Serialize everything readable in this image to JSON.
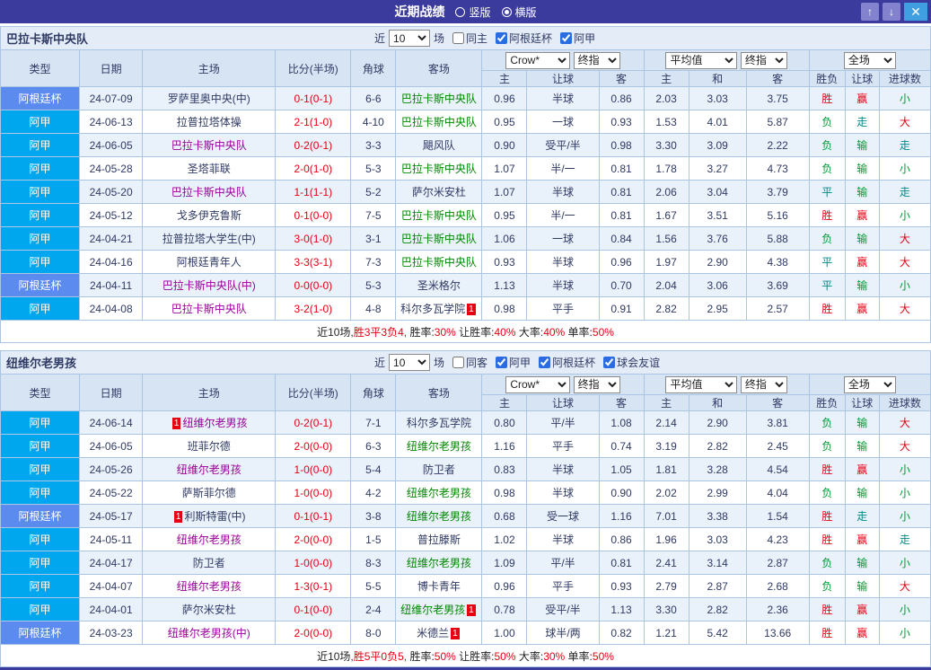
{
  "colors": {
    "titlebar": "#3b3b9e",
    "cup": "#5b8bee",
    "league": "#00a6ee",
    "red": "#e60012",
    "green": "#009933",
    "teal": "#008b8b",
    "focus-home": "#990099",
    "focus-away": "#008800",
    "navy": "#2f3a64",
    "head-bg": "#d7e4f4",
    "bar-bg": "#e4ecf7",
    "row-alt": "#e9f1fa",
    "border": "#aac6e4",
    "btn-arrow": "#8282cf",
    "btn-close": "#3f9fe0"
  },
  "titlebar": {
    "title": "近期战绩",
    "radios": [
      {
        "label": "竖版",
        "checked": false
      },
      {
        "label": "横版",
        "checked": true
      }
    ],
    "buttons": {
      "up": "↑",
      "down": "↓",
      "close": "✕"
    }
  },
  "table_head": {
    "type": "类型",
    "date": "日期",
    "home": "主场",
    "score": "比分(半场)",
    "corner": "角球",
    "away": "客场",
    "odds_home": "主",
    "odds_handicap": "让球",
    "odds_away": "客",
    "avg_home": "主",
    "avg_draw": "和",
    "avg_away": "客",
    "result": "胜负",
    "cover": "让球",
    "goals": "进球数"
  },
  "sections": [
    {
      "team": "巴拉卡斯中央队",
      "filters": {
        "near": "近",
        "count": "10",
        "games": "场",
        "checkboxes": [
          {
            "label": "同主",
            "checked": false
          },
          {
            "label": "阿根廷杯",
            "checked": true
          },
          {
            "label": "阿甲",
            "checked": true
          }
        ]
      },
      "selects": {
        "book": "Crow*",
        "book_mode": "终指",
        "avg": "平均值",
        "avg_mode": "终指",
        "scope": "全场"
      },
      "rows": [
        {
          "type": "阿根廷杯",
          "type_cls": "cup",
          "date": "24-07-09",
          "home": "罗萨里奥中央(中)",
          "home_cls": "other",
          "score": "0-1(0-1)",
          "corner": "6-6",
          "away": "巴拉卡斯中央队",
          "away_cls": "focus-away",
          "o1": "0.96",
          "hc": "半球",
          "o2": "0.86",
          "a1": "2.03",
          "a2": "3.03",
          "a3": "3.75",
          "res": "胜",
          "res_o": "win",
          "cov": "赢",
          "cov_o": "win",
          "gl": "小",
          "gl_o": "under"
        },
        {
          "type": "阿甲",
          "type_cls": "league",
          "date": "24-06-13",
          "home": "拉普拉塔体操",
          "home_cls": "other",
          "score": "2-1(1-0)",
          "corner": "4-10",
          "away": "巴拉卡斯中央队",
          "away_cls": "focus-away",
          "o1": "0.95",
          "hc": "一球",
          "o2": "0.93",
          "a1": "1.53",
          "a2": "4.01",
          "a3": "5.87",
          "res": "负",
          "res_o": "loss",
          "cov": "走",
          "cov_o": "push",
          "gl": "大",
          "gl_o": "over"
        },
        {
          "type": "阿甲",
          "type_cls": "league",
          "date": "24-06-05",
          "home": "巴拉卡斯中央队",
          "home_cls": "focus-home",
          "score": "0-2(0-1)",
          "corner": "3-3",
          "away": "飓风队",
          "away_cls": "other",
          "o1": "0.90",
          "hc": "受平/半",
          "o2": "0.98",
          "a1": "3.30",
          "a2": "3.09",
          "a3": "2.22",
          "res": "负",
          "res_o": "loss",
          "cov": "输",
          "cov_o": "loss",
          "gl": "走",
          "gl_o": "push"
        },
        {
          "type": "阿甲",
          "type_cls": "league",
          "date": "24-05-28",
          "home": "圣塔菲联",
          "home_cls": "other",
          "score": "2-0(1-0)",
          "corner": "5-3",
          "away": "巴拉卡斯中央队",
          "away_cls": "focus-away",
          "o1": "1.07",
          "hc": "半/一",
          "o2": "0.81",
          "a1": "1.78",
          "a2": "3.27",
          "a3": "4.73",
          "res": "负",
          "res_o": "loss",
          "cov": "输",
          "cov_o": "loss",
          "gl": "小",
          "gl_o": "under"
        },
        {
          "type": "阿甲",
          "type_cls": "league",
          "date": "24-05-20",
          "home": "巴拉卡斯中央队",
          "home_cls": "focus-home",
          "score": "1-1(1-1)",
          "corner": "5-2",
          "away": "萨尔米安杜",
          "away_cls": "other",
          "o1": "1.07",
          "hc": "半球",
          "o2": "0.81",
          "a1": "2.06",
          "a2": "3.04",
          "a3": "3.79",
          "res": "平",
          "res_o": "draw",
          "cov": "输",
          "cov_o": "loss",
          "gl": "走",
          "gl_o": "push"
        },
        {
          "type": "阿甲",
          "type_cls": "league",
          "date": "24-05-12",
          "home": "戈多伊克鲁斯",
          "home_cls": "other",
          "score": "0-1(0-0)",
          "corner": "7-5",
          "away": "巴拉卡斯中央队",
          "away_cls": "focus-away",
          "o1": "0.95",
          "hc": "半/一",
          "o2": "0.81",
          "a1": "1.67",
          "a2": "3.51",
          "a3": "5.16",
          "res": "胜",
          "res_o": "win",
          "cov": "赢",
          "cov_o": "win",
          "gl": "小",
          "gl_o": "under"
        },
        {
          "type": "阿甲",
          "type_cls": "league",
          "date": "24-04-21",
          "home": "拉普拉塔大学生(中)",
          "home_cls": "other",
          "score": "3-0(1-0)",
          "corner": "3-1",
          "away": "巴拉卡斯中央队",
          "away_cls": "focus-away",
          "o1": "1.06",
          "hc": "一球",
          "o2": "0.84",
          "a1": "1.56",
          "a2": "3.76",
          "a3": "5.88",
          "res": "负",
          "res_o": "loss",
          "cov": "输",
          "cov_o": "loss",
          "gl": "大",
          "gl_o": "over"
        },
        {
          "type": "阿甲",
          "type_cls": "league",
          "date": "24-04-16",
          "home": "阿根廷青年人",
          "home_cls": "other",
          "score": "3-3(3-1)",
          "corner": "7-3",
          "away": "巴拉卡斯中央队",
          "away_cls": "focus-away",
          "o1": "0.93",
          "hc": "半球",
          "o2": "0.96",
          "a1": "1.97",
          "a2": "2.90",
          "a3": "4.38",
          "res": "平",
          "res_o": "draw",
          "cov": "赢",
          "cov_o": "win",
          "gl": "大",
          "gl_o": "over"
        },
        {
          "type": "阿根廷杯",
          "type_cls": "cup",
          "date": "24-04-11",
          "home": "巴拉卡斯中央队(中)",
          "home_cls": "focus-home",
          "score": "0-0(0-0)",
          "corner": "5-3",
          "away": "圣米格尔",
          "away_cls": "other",
          "o1": "1.13",
          "hc": "半球",
          "o2": "0.70",
          "a1": "2.04",
          "a2": "3.06",
          "a3": "3.69",
          "res": "平",
          "res_o": "draw",
          "cov": "输",
          "cov_o": "loss",
          "gl": "小",
          "gl_o": "under"
        },
        {
          "type": "阿甲",
          "type_cls": "league",
          "date": "24-04-08",
          "home": "巴拉卡斯中央队",
          "home_cls": "focus-home",
          "score": "3-2(1-0)",
          "corner": "4-8",
          "away": "科尔多瓦学院",
          "away_cls": "other",
          "away_badge": {
            "pos": "after",
            "text": "1"
          },
          "o1": "0.98",
          "hc": "平手",
          "o2": "0.91",
          "a1": "2.82",
          "a2": "2.95",
          "a3": "2.57",
          "res": "胜",
          "res_o": "win",
          "cov": "赢",
          "cov_o": "win",
          "gl": "大",
          "gl_o": "over"
        }
      ],
      "footer": [
        {
          "text": "近10场,",
          "red": false
        },
        {
          "text": "胜3平3负4,",
          "red": true
        },
        {
          "text": " 胜率:",
          "red": false
        },
        {
          "text": "30%",
          "red": true
        },
        {
          "text": " 让胜率:",
          "red": false
        },
        {
          "text": "40%",
          "red": true
        },
        {
          "text": " 大率:",
          "red": false
        },
        {
          "text": "40%",
          "red": true
        },
        {
          "text": " 单率:",
          "red": false
        },
        {
          "text": "50%",
          "red": true
        }
      ]
    },
    {
      "team": "纽维尔老男孩",
      "filters": {
        "near": "近",
        "count": "10",
        "games": "场",
        "checkboxes": [
          {
            "label": "同客",
            "checked": false
          },
          {
            "label": "阿甲",
            "checked": true
          },
          {
            "label": "阿根廷杯",
            "checked": true
          },
          {
            "label": "球会友谊",
            "checked": true
          }
        ]
      },
      "selects": {
        "book": "Crow*",
        "book_mode": "终指",
        "avg": "平均值",
        "avg_mode": "终指",
        "scope": "全场"
      },
      "rows": [
        {
          "type": "阿甲",
          "type_cls": "league",
          "date": "24-06-14",
          "home": "纽维尔老男孩",
          "home_cls": "focus-home",
          "home_badge": {
            "pos": "before",
            "text": "1"
          },
          "score": "0-2(0-1)",
          "corner": "7-1",
          "away": "科尔多瓦学院",
          "away_cls": "other",
          "o1": "0.80",
          "hc": "平/半",
          "o2": "1.08",
          "a1": "2.14",
          "a2": "2.90",
          "a3": "3.81",
          "res": "负",
          "res_o": "loss",
          "cov": "输",
          "cov_o": "loss",
          "gl": "大",
          "gl_o": "over"
        },
        {
          "type": "阿甲",
          "type_cls": "league",
          "date": "24-06-05",
          "home": "班菲尔德",
          "home_cls": "other",
          "score": "2-0(0-0)",
          "corner": "6-3",
          "away": "纽维尔老男孩",
          "away_cls": "focus-away",
          "o1": "1.16",
          "hc": "平手",
          "o2": "0.74",
          "a1": "3.19",
          "a2": "2.82",
          "a3": "2.45",
          "res": "负",
          "res_o": "loss",
          "cov": "输",
          "cov_o": "loss",
          "gl": "大",
          "gl_o": "over"
        },
        {
          "type": "阿甲",
          "type_cls": "league",
          "date": "24-05-26",
          "home": "纽维尔老男孩",
          "home_cls": "focus-home",
          "score": "1-0(0-0)",
          "corner": "5-4",
          "away": "防卫者",
          "away_cls": "other",
          "o1": "0.83",
          "hc": "半球",
          "o2": "1.05",
          "a1": "1.81",
          "a2": "3.28",
          "a3": "4.54",
          "res": "胜",
          "res_o": "win",
          "cov": "赢",
          "cov_o": "win",
          "gl": "小",
          "gl_o": "under"
        },
        {
          "type": "阿甲",
          "type_cls": "league",
          "date": "24-05-22",
          "home": "萨斯菲尔德",
          "home_cls": "other",
          "score": "1-0(0-0)",
          "corner": "4-2",
          "away": "纽维尔老男孩",
          "away_cls": "focus-away",
          "o1": "0.98",
          "hc": "半球",
          "o2": "0.90",
          "a1": "2.02",
          "a2": "2.99",
          "a3": "4.04",
          "res": "负",
          "res_o": "loss",
          "cov": "输",
          "cov_o": "loss",
          "gl": "小",
          "gl_o": "under"
        },
        {
          "type": "阿根廷杯",
          "type_cls": "cup",
          "date": "24-05-17",
          "home": "利斯特雷(中)",
          "home_cls": "other",
          "home_badge": {
            "pos": "before",
            "text": "1"
          },
          "score": "0-1(0-1)",
          "corner": "3-8",
          "away": "纽维尔老男孩",
          "away_cls": "focus-away",
          "o1": "0.68",
          "hc": "受一球",
          "o2": "1.16",
          "a1": "7.01",
          "a2": "3.38",
          "a3": "1.54",
          "res": "胜",
          "res_o": "win",
          "cov": "走",
          "cov_o": "push",
          "gl": "小",
          "gl_o": "under"
        },
        {
          "type": "阿甲",
          "type_cls": "league",
          "date": "24-05-11",
          "home": "纽维尔老男孩",
          "home_cls": "focus-home",
          "score": "2-0(0-0)",
          "corner": "1-5",
          "away": "普拉滕斯",
          "away_cls": "other",
          "o1": "1.02",
          "hc": "半球",
          "o2": "0.86",
          "a1": "1.96",
          "a2": "3.03",
          "a3": "4.23",
          "res": "胜",
          "res_o": "win",
          "cov": "赢",
          "cov_o": "win",
          "gl": "走",
          "gl_o": "push"
        },
        {
          "type": "阿甲",
          "type_cls": "league",
          "date": "24-04-17",
          "home": "防卫者",
          "home_cls": "other",
          "score": "1-0(0-0)",
          "corner": "8-3",
          "away": "纽维尔老男孩",
          "away_cls": "focus-away",
          "o1": "1.09",
          "hc": "平/半",
          "o2": "0.81",
          "a1": "2.41",
          "a2": "3.14",
          "a3": "2.87",
          "res": "负",
          "res_o": "loss",
          "cov": "输",
          "cov_o": "loss",
          "gl": "小",
          "gl_o": "under"
        },
        {
          "type": "阿甲",
          "type_cls": "league",
          "date": "24-04-07",
          "home": "纽维尔老男孩",
          "home_cls": "focus-home",
          "score": "1-3(0-1)",
          "corner": "5-5",
          "away": "博卡青年",
          "away_cls": "other",
          "o1": "0.96",
          "hc": "平手",
          "o2": "0.93",
          "a1": "2.79",
          "a2": "2.87",
          "a3": "2.68",
          "res": "负",
          "res_o": "loss",
          "cov": "输",
          "cov_o": "loss",
          "gl": "大",
          "gl_o": "over"
        },
        {
          "type": "阿甲",
          "type_cls": "league",
          "date": "24-04-01",
          "home": "萨尔米安杜",
          "home_cls": "other",
          "score": "0-1(0-0)",
          "corner": "2-4",
          "away": "纽维尔老男孩",
          "away_cls": "focus-away",
          "away_badge": {
            "pos": "after",
            "text": "1"
          },
          "o1": "0.78",
          "hc": "受平/半",
          "o2": "1.13",
          "a1": "3.30",
          "a2": "2.82",
          "a3": "2.36",
          "res": "胜",
          "res_o": "win",
          "cov": "赢",
          "cov_o": "win",
          "gl": "小",
          "gl_o": "under"
        },
        {
          "type": "阿根廷杯",
          "type_cls": "cup",
          "date": "24-03-23",
          "home": "纽维尔老男孩(中)",
          "home_cls": "focus-home",
          "score": "2-0(0-0)",
          "corner": "8-0",
          "away": "米德兰",
          "away_cls": "other",
          "away_badge": {
            "pos": "after",
            "text": "1"
          },
          "o1": "1.00",
          "hc": "球半/两",
          "o2": "0.82",
          "a1": "1.21",
          "a2": "5.42",
          "a3": "13.66",
          "res": "胜",
          "res_o": "win",
          "cov": "赢",
          "cov_o": "win",
          "gl": "小",
          "gl_o": "under"
        }
      ],
      "footer": [
        {
          "text": "近10场,",
          "red": false
        },
        {
          "text": "胜5平0负5,",
          "red": true
        },
        {
          "text": " 胜率:",
          "red": false
        },
        {
          "text": "50%",
          "red": true
        },
        {
          "text": " 让胜率:",
          "red": false
        },
        {
          "text": "50%",
          "red": true
        },
        {
          "text": " 大率:",
          "red": false
        },
        {
          "text": "30%",
          "red": true
        },
        {
          "text": " 单率:",
          "red": false
        },
        {
          "text": "50%",
          "red": true
        }
      ]
    }
  ]
}
